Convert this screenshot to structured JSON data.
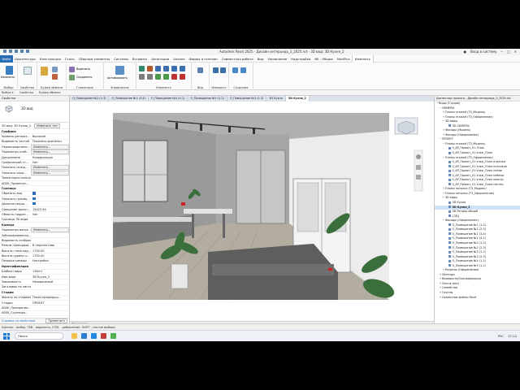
{
  "window": {
    "title": "Autodesk Revit 2025 - Дизайн интерьера_3_2025.rvt - 3D вид: 3D Кухня_2",
    "sign_in": "Вход в систему"
  },
  "menu": {
    "tabs": [
      "Файл",
      "Архитектура",
      "Конструкция",
      "Сталь",
      "Сборные элементы",
      "Системы",
      "Вставить",
      "Аннотации",
      "Анализ",
      "Формы и генплан",
      "Совместная работа",
      "Вид",
      "Управление",
      "Надстройки",
      "BS - Общие",
      "ModPlus",
      "Изменить"
    ],
    "active_index": 16
  },
  "ribbon": {
    "groups": [
      "Выбор",
      "Свойства",
      "Буфер обмена",
      "Геометрия",
      "Управление",
      "Изменить",
      "Вид",
      "Измерить",
      "Создание"
    ],
    "modify_label": "Изменить",
    "activate_label": "Активировать",
    "cut_label": "Вырезать",
    "join_label": "Соединить"
  },
  "optionbar": {
    "select": "Выбор ▾",
    "props": "Свойства",
    "clipboard": "Буфер обмена"
  },
  "properties": {
    "header": "Свойства",
    "type_name": "3D вид",
    "instance": "3D вид: 3D Кухня_2",
    "edit_type": "Изменить тип",
    "rows": [
      {
        "k": "Графика",
        "cat": true
      },
      {
        "k": "Уровень детализ...",
        "v": "Высокий"
      },
      {
        "k": "Видимость частей",
        "v": "Показать оригинал"
      },
      {
        "k": "Переопределени...",
        "v": "Изменить..."
      },
      {
        "k": "Параметры отоб...",
        "v": "Изменить..."
      },
      {
        "k": "Дисциплина",
        "v": "Координация"
      },
      {
        "k": "Графический ст...",
        "v": "Нет"
      },
      {
        "k": "Показать солнц...",
        "v": "Изменить..."
      },
      {
        "k": "Показать скры...",
        "v": "Изменить..."
      },
      {
        "k": "Траектория солнца",
        "v": ""
      },
      {
        "k": "ADSK_Примечан...",
        "v": ""
      },
      {
        "k": "Границы",
        "cat": true
      },
      {
        "k": "Обрезать вид",
        "v": "check"
      },
      {
        "k": "Показать границ...",
        "v": "check"
      },
      {
        "k": "Дальняя секущ...",
        "v": "check"
      },
      {
        "k": "Смещение дальн...",
        "v": "15422.94"
      },
      {
        "k": "Область подрез...",
        "v": "Нет"
      },
      {
        "k": "Границы 3D вида",
        "v": ""
      },
      {
        "k": "Камера",
        "cat": true
      },
      {
        "k": "Параметры визуа...",
        "v": "Изменить..."
      },
      {
        "k": "Заблокированная...",
        "v": ""
      },
      {
        "k": "Видимость отображ...",
        "v": ""
      },
      {
        "k": "Режим проециров...",
        "v": "В перспективе"
      },
      {
        "k": "Высота глаза над...",
        "v": "1750.00"
      },
      {
        "k": "Высота уровня ц...",
        "v": "1750.00"
      },
      {
        "k": "Позиция камеры",
        "v": "Настройка"
      },
      {
        "k": "Идентификация",
        "cat": true
      },
      {
        "k": "Шаблон вида",
        "v": "<Нет>"
      },
      {
        "k": "Имя вида",
        "v": "3D Кухня_2"
      },
      {
        "k": "Зависимость",
        "v": "Независимый"
      },
      {
        "k": "Заголовок на листе",
        "v": ""
      },
      {
        "k": "Стадии",
        "cat": true
      },
      {
        "k": "Фильтр по стадиям",
        "v": "Показ предыдущ..."
      },
      {
        "k": "Стадия",
        "v": "ПРОЕКТ"
      },
      {
        "k": "ADSK_Принципиа...",
        "v": ""
      },
      {
        "k": "ADSK_Группиро...",
        "v": ""
      }
    ],
    "help": "Справка по свойствам",
    "apply": "Применить"
  },
  "view_tabs": [
    "О_Помещение №2 (2-3)",
    "О_Помещение №1 (3-4)",
    "О_Помещение №4 (4-1)",
    "О_Помещение №5 (1-2)",
    "О_Помещение №3 (2-3)",
    "3D Кухня",
    "3D Кухня_2"
  ],
  "active_view_tab": 6,
  "browser": {
    "header": "Диспетчер проекта - Дизайн интерьера_3_2025.rvt",
    "items": [
      {
        "t": "Виды (Стадия)",
        "lvl": 0,
        "sym": "−"
      },
      {
        "t": "ОБМЕРЫ",
        "lvl": 1,
        "sym": "−"
      },
      {
        "t": "Планы этажей (ТЗ_Модель)",
        "lvl": 2,
        "sym": "+"
      },
      {
        "t": "Планы этажей (ТЗ_Оформление)",
        "lvl": 2,
        "sym": "+"
      },
      {
        "t": "3D виды",
        "lvl": 2,
        "sym": "−"
      },
      {
        "t": "3D ОБМЕРЫ",
        "lvl": 3,
        "sym": "",
        "ic": true
      },
      {
        "t": "Фасады (Модель)",
        "lvl": 2,
        "sym": "+"
      },
      {
        "t": "Фасады (Оформление)",
        "lvl": 2,
        "sym": "+"
      },
      {
        "t": "ПРОЕКТ",
        "lvl": 1,
        "sym": "−"
      },
      {
        "t": "Планы этажей (ТЗ_Модель)",
        "lvl": 2,
        "sym": "−"
      },
      {
        "t": "0_АР_Проект_01 Этаж",
        "lvl": 3,
        "sym": "",
        "ic": true
      },
      {
        "t": "0_АР_Проект_01 этаж_План",
        "lvl": 3,
        "sym": "",
        "ic": true
      },
      {
        "t": "Планы этажей (ТЗ_Оформление)",
        "lvl": 2,
        "sym": "−"
      },
      {
        "t": "0_АР_Проект_01 этаж_План отделки",
        "lvl": 3,
        "sym": "",
        "ic": true
      },
      {
        "t": "0_АР_Проект_01 этаж_План потолков",
        "lvl": 3,
        "sym": "",
        "ic": true
      },
      {
        "t": "0_АР_Проект_01 этаж_План полов",
        "lvl": 3,
        "sym": "",
        "ic": true
      },
      {
        "t": "0_АР_Проект_01 этаж_План мебели",
        "lvl": 3,
        "sym": "",
        "ic": true
      },
      {
        "t": "0_АР_Проект_01 этаж_План электр.",
        "lvl": 3,
        "sym": "",
        "ic": true
      },
      {
        "t": "0_АР_Проект_01 этаж_План сантех.",
        "lvl": 3,
        "sym": "",
        "ic": true
      },
      {
        "t": "Планы потолка (ТЗ_Модель)",
        "lvl": 2,
        "sym": "+"
      },
      {
        "t": "Планы потолка (ТЗ_Оформление)",
        "lvl": 2,
        "sym": "+"
      },
      {
        "t": "3D виды",
        "lvl": 2,
        "sym": "−"
      },
      {
        "t": "3D Кухня",
        "lvl": 3,
        "sym": "",
        "ic": true
      },
      {
        "t": "3D Кухня_2",
        "lvl": 3,
        "sym": "",
        "ic": true,
        "sel": true
      },
      {
        "t": "3D Рендер общий",
        "lvl": 3,
        "sym": "",
        "ic": true
      },
      {
        "t": "{3D}",
        "lvl": 3,
        "sym": "",
        "ic": true
      },
      {
        "t": "Фасады (Оформление)",
        "lvl": 2,
        "sym": "−"
      },
      {
        "t": "О_Помещение №1 (1-2)",
        "lvl": 3,
        "sym": "",
        "ic": true
      },
      {
        "t": "О_Помещение №1 (2-3)",
        "lvl": 3,
        "sym": "",
        "ic": true
      },
      {
        "t": "О_Помещение №1 (3-4)",
        "lvl": 3,
        "sym": "",
        "ic": true
      },
      {
        "t": "О_Помещение №1 (4-1)",
        "lvl": 3,
        "sym": "",
        "ic": true
      },
      {
        "t": "О_Помещение №2 (1-2)",
        "lvl": 3,
        "sym": "",
        "ic": true
      },
      {
        "t": "О_Помещение №2 (2-3)",
        "lvl": 3,
        "sym": "",
        "ic": true
      },
      {
        "t": "О_Помещение №3 (1-2)",
        "lvl": 3,
        "sym": "",
        "ic": true
      },
      {
        "t": "О_Помещение №3 (2-3)",
        "lvl": 3,
        "sym": "",
        "ic": true
      },
      {
        "t": "О_Помещение №4 (1-2)",
        "lvl": 3,
        "sym": "",
        "ic": true
      },
      {
        "t": "О_Помещение №5 (1-2)",
        "lvl": 3,
        "sym": "",
        "ic": true
      },
      {
        "t": "Разрезы (Оформление)",
        "lvl": 2,
        "sym": "+"
      },
      {
        "t": "Легенды",
        "lvl": 1,
        "sym": "+"
      },
      {
        "t": "Ведомости/Спецификации",
        "lvl": 1,
        "sym": "+"
      },
      {
        "t": "Листы (все)",
        "lvl": 1,
        "sym": "+"
      },
      {
        "t": "Семейства",
        "lvl": 1,
        "sym": "+"
      },
      {
        "t": "Группы",
        "lvl": 1,
        "sym": "+"
      },
      {
        "t": "Связанные файлы Revit",
        "lvl": 1,
        "sym": "+"
      }
    ]
  },
  "view_control": "Перспектива",
  "status": "Щелчок - выбор, TAB - варианты, CTRL - добавление, SHIFT - снятие выбора.",
  "taskbar": {
    "search": "Поиск",
    "time": "17:12",
    "lang": "РУС"
  }
}
